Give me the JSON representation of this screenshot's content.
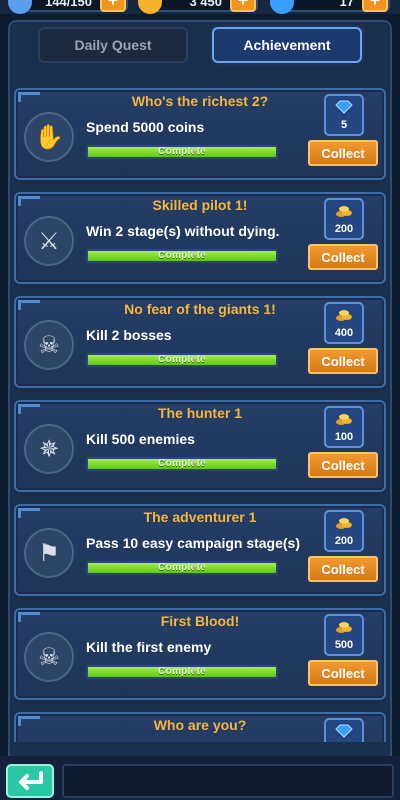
{
  "topbar": {
    "resources": [
      {
        "name": "energy",
        "value": "144/150",
        "icon": "lightning-icon",
        "color": "#5b9ef0"
      },
      {
        "name": "coins",
        "value": "3 450",
        "icon": "coin-icon",
        "color": "#f5b22c"
      },
      {
        "name": "gems",
        "value": "17",
        "icon": "gem-icon",
        "color": "#3aa0ff"
      }
    ]
  },
  "tabs": [
    {
      "label": "Daily Quest",
      "active": false
    },
    {
      "label": "Achievement",
      "active": true
    }
  ],
  "achievements": [
    {
      "title": "Who's the richest 2?",
      "description": "Spend 5000 coins",
      "icon": "coins-in-hand-icon",
      "progress": 1.0,
      "status": "Complete",
      "reward_type": "gem-icon",
      "reward_amount": "5",
      "button": "Collect"
    },
    {
      "title": "Skilled pilot 1!",
      "description": "Win 2 stage(s) without dying.",
      "icon": "winged-sword-icon",
      "progress": 1.0,
      "status": "Complete",
      "reward_type": "coin-stack-icon",
      "reward_amount": "200",
      "button": "Collect"
    },
    {
      "title": "No fear of the giants 1!",
      "description": "Kill 2 bosses",
      "icon": "boss-skull-icon",
      "progress": 1.0,
      "status": "Complete",
      "reward_type": "coin-stack-icon",
      "reward_amount": "400",
      "button": "Collect"
    },
    {
      "title": "The hunter 1",
      "description": "Kill 500 enemies",
      "icon": "bug-icon",
      "progress": 1.0,
      "status": "Complete",
      "reward_type": "coin-stack-icon",
      "reward_amount": "100",
      "button": "Collect"
    },
    {
      "title": "The adventurer 1",
      "description": "Pass 10 easy campaign stage(s)",
      "icon": "skull-flag-icon",
      "progress": 1.0,
      "status": "Complete",
      "reward_type": "coin-stack-icon",
      "reward_amount": "200",
      "button": "Collect"
    },
    {
      "title": "First Blood!",
      "description": "Kill the first enemy",
      "icon": "skull-crossbones-icon",
      "progress": 1.0,
      "status": "Complete",
      "reward_type": "coin-stack-icon",
      "reward_amount": "500",
      "button": "Collect"
    },
    {
      "title": "Who are you?",
      "description": "",
      "icon": "",
      "progress": 0,
      "status": "",
      "reward_type": "gem-icon",
      "reward_amount": "",
      "button": ""
    }
  ],
  "colors": {
    "accent_orange": "#f0941f",
    "title_gold": "#f3b640",
    "progress_green": "#7ed83a",
    "back_teal": "#2cc7a5"
  }
}
